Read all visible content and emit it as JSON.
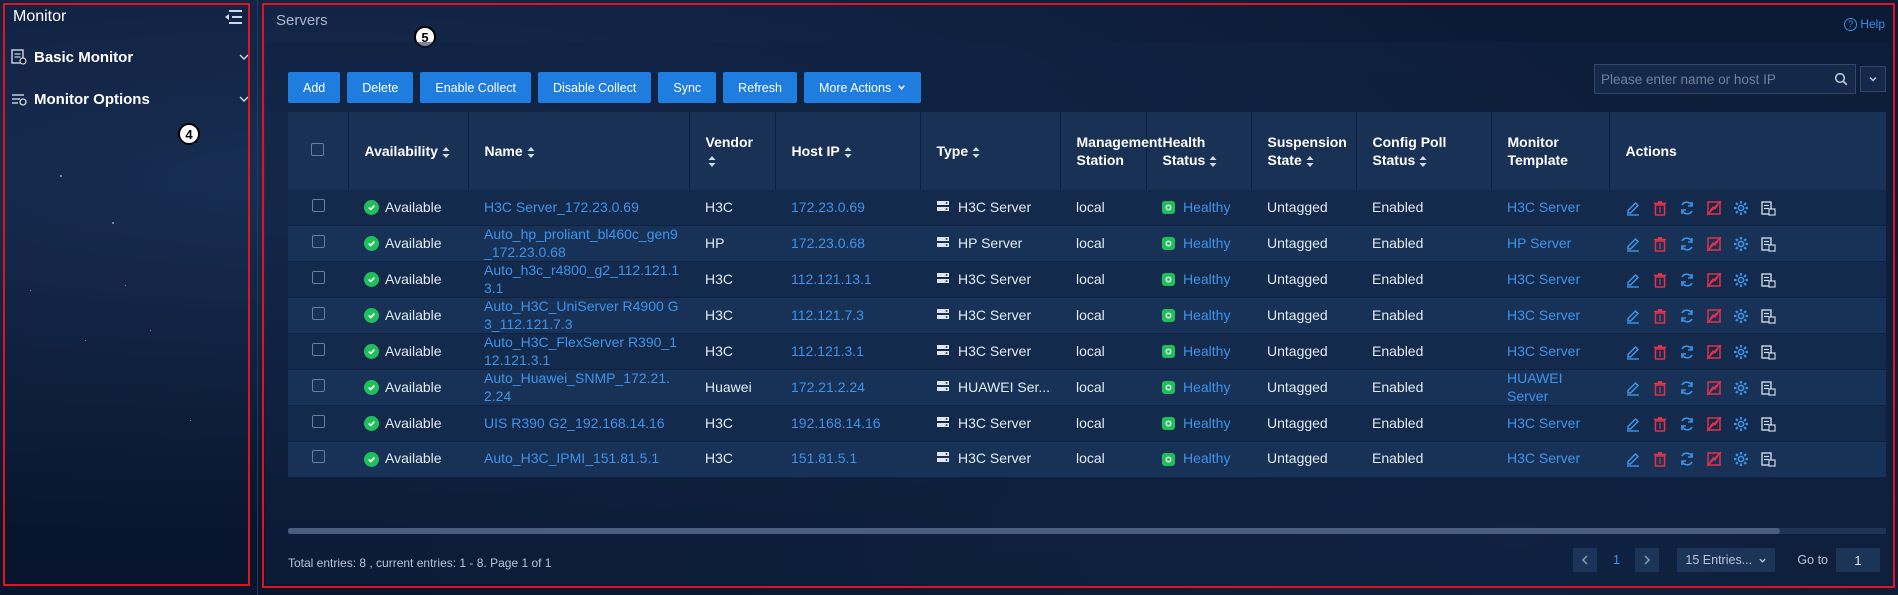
{
  "sidebar": {
    "title": "Monitor",
    "items": [
      {
        "label": "Basic Monitor",
        "icon": "basic-monitor-icon"
      },
      {
        "label": "Monitor Options",
        "icon": "monitor-options-icon"
      }
    ],
    "marker": "4"
  },
  "main": {
    "title": "Servers",
    "help": "Help",
    "marker": "5"
  },
  "toolbar": {
    "add": "Add",
    "delete": "Delete",
    "enable_collect": "Enable Collect",
    "disable_collect": "Disable Collect",
    "sync": "Sync",
    "refresh": "Refresh",
    "more_actions": "More Actions"
  },
  "search": {
    "placeholder": "Please enter name or host IP"
  },
  "table": {
    "headers": {
      "availability": "Availability",
      "name": "Name",
      "vendor": "Vendor",
      "host_ip": "Host IP",
      "type": "Type",
      "mgmt_station": "Management Station",
      "health_status": "Health Status",
      "suspension_state": "Suspension State",
      "config_poll": "Config Poll Status",
      "monitor_template": "Monitor Template",
      "actions": "Actions"
    },
    "rows": [
      {
        "availability": "Available",
        "name": "H3C Server_172.23.0.69",
        "vendor": "H3C",
        "ip": "172.23.0.69",
        "type": "H3C Server",
        "station": "local",
        "health": "Healthy",
        "suspension": "Untagged",
        "config": "Enabled",
        "template": "H3C Server"
      },
      {
        "availability": "Available",
        "name": "Auto_hp_proliant_bl460c_gen9_172.23.0.68",
        "vendor": "HP",
        "ip": "172.23.0.68",
        "type": "HP Server",
        "station": "local",
        "health": "Healthy",
        "suspension": "Untagged",
        "config": "Enabled",
        "template": "HP Server"
      },
      {
        "availability": "Available",
        "name": "Auto_h3c_r4800_g2_112.121.13.1",
        "vendor": "H3C",
        "ip": "112.121.13.1",
        "type": "H3C Server",
        "station": "local",
        "health": "Healthy",
        "suspension": "Untagged",
        "config": "Enabled",
        "template": "H3C Server"
      },
      {
        "availability": "Available",
        "name": "Auto_H3C_UniServer R4900 G3_112.121.7.3",
        "vendor": "H3C",
        "ip": "112.121.7.3",
        "type": "H3C Server",
        "station": "local",
        "health": "Healthy",
        "suspension": "Untagged",
        "config": "Enabled",
        "template": "H3C Server"
      },
      {
        "availability": "Available",
        "name": "Auto_H3C_FlexServer R390_112.121.3.1",
        "vendor": "H3C",
        "ip": "112.121.3.1",
        "type": "H3C Server",
        "station": "local",
        "health": "Healthy",
        "suspension": "Untagged",
        "config": "Enabled",
        "template": "H3C Server"
      },
      {
        "availability": "Available",
        "name": "Auto_Huawei_SNMP_172.21.2.24",
        "vendor": "Huawei",
        "ip": "172.21.2.24",
        "type": "HUAWEI Ser...",
        "station": "local",
        "health": "Healthy",
        "suspension": "Untagged",
        "config": "Enabled",
        "template": "HUAWEI Server"
      },
      {
        "availability": "Available",
        "name": "UIS R390 G2_192.168.14.16",
        "vendor": "H3C",
        "ip": "192.168.14.16",
        "type": "H3C Server",
        "station": "local",
        "health": "Healthy",
        "suspension": "Untagged",
        "config": "Enabled",
        "template": "H3C Server"
      },
      {
        "availability": "Available",
        "name": "Auto_H3C_IPMI_151.81.5.1",
        "vendor": "H3C",
        "ip": "151.81.5.1",
        "type": "H3C Server",
        "station": "local",
        "health": "Healthy",
        "suspension": "Untagged",
        "config": "Enabled",
        "template": "H3C Server"
      }
    ]
  },
  "footer": {
    "summary": "Total entries: 8 , current entries: 1 - 8. Page 1 of 1",
    "page": "1",
    "page_size": "15 Entries...",
    "goto_label": "Go to",
    "goto_value": "1"
  },
  "colors": {
    "accent": "#1f7de0",
    "link": "#3d93ea",
    "ok": "#1fbf5c",
    "delete": "#e0334a",
    "frame": "#e0141e"
  }
}
